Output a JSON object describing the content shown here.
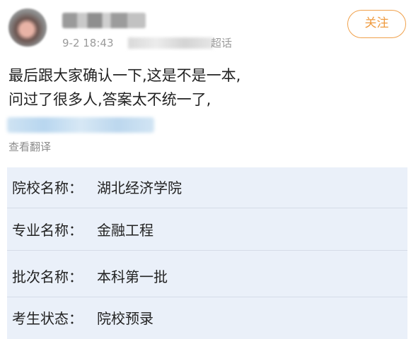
{
  "post": {
    "time": "9-2 18:43",
    "source_suffix": "超话",
    "follow_label": "关注",
    "lines": [
      "最后跟大家确认一下,这是不是一本,",
      "问过了很多人,答案太不统一了,"
    ],
    "translate_label": "查看翻译"
  },
  "card": {
    "rows": [
      {
        "label": "院校名称：",
        "value": "湖北经济学院"
      },
      {
        "label": "专业名称：",
        "value": "金融工程"
      },
      {
        "label": "批次名称：",
        "value": "本科第一批"
      },
      {
        "label": "考生状态：",
        "value": "院校预录"
      }
    ]
  },
  "colors": {
    "accent": "#ef9a3e",
    "card_background": "#eaf0f9",
    "meta_text": "#9b9b9b"
  }
}
